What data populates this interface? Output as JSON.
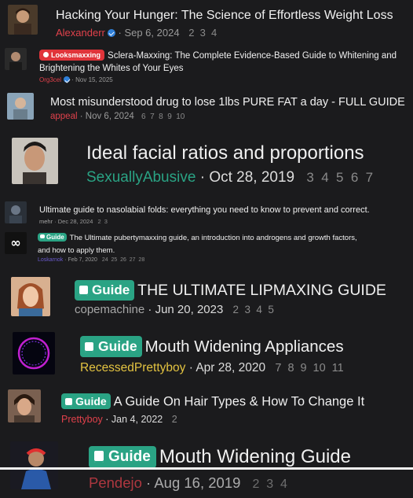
{
  "threads": [
    {
      "title": "Hacking Your Hunger: The Science of Effortless Weight Loss",
      "author": "Alexanderr",
      "date": "Sep 6, 2024",
      "pages": [
        "2",
        "3",
        "4"
      ],
      "verified": true
    },
    {
      "prefix": "Looksmaxxing",
      "title_line1": "Sclera-Maxxing: The Complete Evidence-Based Guide to Whitening and",
      "title_line2": "Brightening the Whites of Your Eyes",
      "author": "Org3cel",
      "date": "Nov 15, 2025",
      "verified": true
    },
    {
      "title": "Most misunderstood drug to lose 1lbs PURE FAT a day - FULL GUIDE",
      "author": "appeal",
      "date": "Nov 6, 2024",
      "pages": [
        "6",
        "7",
        "8",
        "9",
        "10"
      ]
    },
    {
      "title": "Ideal facial ratios and proportions",
      "author": "SexuallyAbusive",
      "date": "Oct 28, 2019",
      "pages": [
        "3",
        "4",
        "5",
        "6",
        "7"
      ]
    },
    {
      "title": "Ultimate guide to nasolabial folds: everything you need to know to prevent and correct.",
      "author": "mehr",
      "date": "Dec 28, 2024",
      "pages": [
        "2",
        "3"
      ]
    },
    {
      "prefix": "Guide",
      "title_line1": "The Ultimate pubertymaxxing guide, an introduction into androgens and growth factors,",
      "title_line2": "and how to apply them.",
      "author": "Loskarnok",
      "date": "Feb 7, 2020",
      "pages": [
        "24",
        "25",
        "26",
        "27",
        "28"
      ]
    },
    {
      "prefix": "Guide",
      "title": "THE ULTIMATE LIPMAXING GUIDE",
      "author": "copemachine",
      "date": "Jun 20, 2023",
      "pages": [
        "2",
        "3",
        "4",
        "5"
      ]
    },
    {
      "prefix": "Guide",
      "title": "Mouth Widening Appliances",
      "author": "RecessedPrettyboy",
      "date": "Apr 28, 2020",
      "pages": [
        "7",
        "8",
        "9",
        "10",
        "11"
      ]
    },
    {
      "prefix": "Guide",
      "title": "A Guide On Hair Types & How To Change It",
      "author": "Prettyboy",
      "date": "Jan 4, 2022",
      "pages": [
        "2"
      ]
    },
    {
      "prefix": "Guide",
      "title": "Mouth Widening Guide",
      "author": "Pendejo",
      "date": "Aug 16, 2019",
      "pages": [
        "2",
        "3",
        "4"
      ]
    }
  ],
  "colors": {
    "background": "#1b1b1d",
    "guide_badge": "#2aa384",
    "looksmaxxing_badge": "#e0343a",
    "author_red": "#e0414b",
    "author_green": "#2aa384",
    "author_yellow": "#e3c341",
    "author_grey": "#a7a7a7",
    "meta_grey": "#9a9a9a"
  },
  "separator": " · "
}
